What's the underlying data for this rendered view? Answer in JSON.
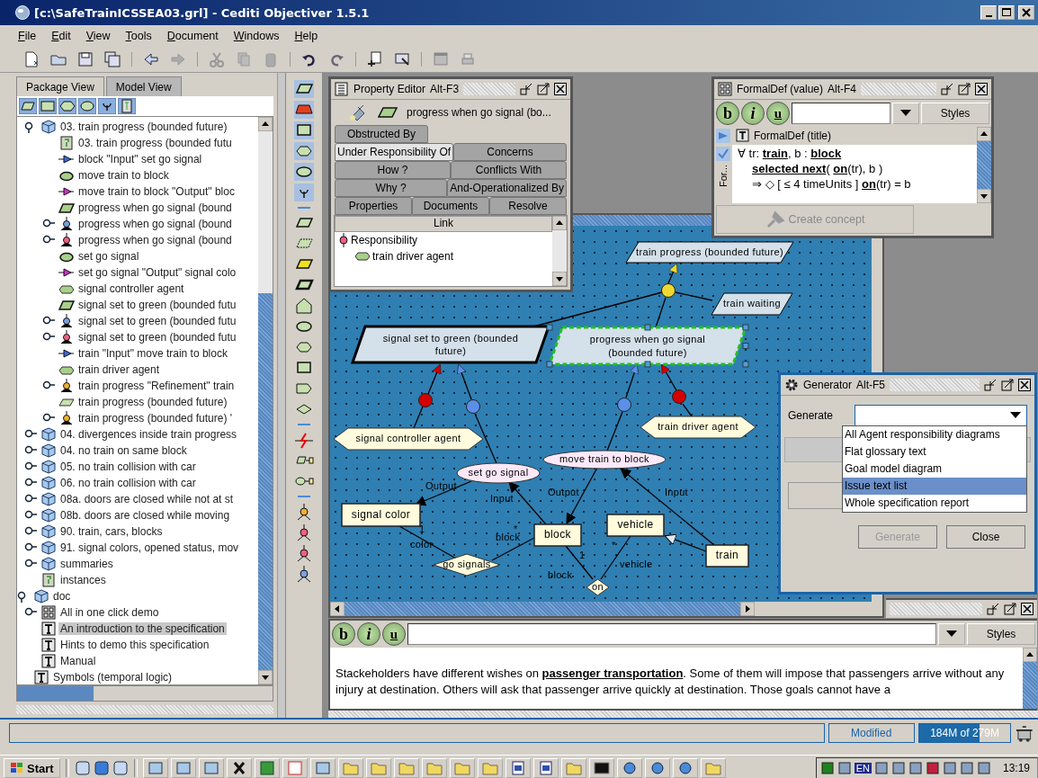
{
  "window": {
    "title": "[c:\\SafeTrainICSSEA03.grl] - Cediti Objectiver 1.5.1"
  },
  "menu": [
    "File",
    "Edit",
    "View",
    "Tools",
    "Document",
    "Windows",
    "Help"
  ],
  "left_tabs": [
    {
      "label": "Package View",
      "selected": true
    },
    {
      "label": "Model View",
      "selected": false
    }
  ],
  "tree": {
    "items": [
      {
        "children": [
          {
            "label": "03. train progress (bounded future)",
            "kind": "package",
            "expanded": true,
            "selected": false,
            "children": [
              {
                "label": "03. train progress (bounded futu",
                "kind": "diagram",
                "selected": false
              },
              {
                "label": "block \"Input\" set go signal",
                "kind": "input",
                "selected": false
              },
              {
                "label": "move train to block",
                "kind": "operation",
                "selected": false
              },
              {
                "label": "move train to block \"Output\" bloc",
                "kind": "output",
                "selected": false
              },
              {
                "label": "progress when go signal (bound",
                "kind": "goal",
                "selected": false
              },
              {
                "label": "progress when go signal (bound",
                "kind": "and-refinement",
                "expanded": false,
                "selected": false
              },
              {
                "label": "progress when go signal (bound",
                "kind": "responsibility",
                "expanded": false,
                "selected": false
              },
              {
                "label": "set go signal",
                "kind": "operation",
                "selected": false
              },
              {
                "label": "set go signal \"Output\" signal colo",
                "kind": "output",
                "selected": false
              },
              {
                "label": "signal controller agent",
                "kind": "agent",
                "selected": false
              },
              {
                "label": "signal set to green (bounded futu",
                "kind": "goal",
                "selected": false
              },
              {
                "label": "signal set to green (bounded futu",
                "kind": "and-refinement",
                "expanded": false,
                "selected": false
              },
              {
                "label": "signal set to green (bounded futu",
                "kind": "responsibility",
                "expanded": false,
                "selected": false
              },
              {
                "label": "train \"Input\" move train to block",
                "kind": "input",
                "selected": false
              },
              {
                "label": "train driver agent",
                "kind": "agent",
                "selected": false
              },
              {
                "label": "train progress \"Refinement\" train",
                "kind": "refinement",
                "expanded": false,
                "selected": false
              },
              {
                "label": "train progress (bounded future)",
                "kind": "goal-plain",
                "selected": false
              },
              {
                "label": "train progress (bounded future) '",
                "kind": "refinement",
                "expanded": false,
                "selected": false
              }
            ]
          },
          {
            "label": "04. divergences inside train progress",
            "kind": "package",
            "expanded": false,
            "selected": false
          },
          {
            "label": "04. no train on same block",
            "kind": "package",
            "expanded": false,
            "selected": false
          },
          {
            "label": "05. no train collision with car",
            "kind": "package",
            "expanded": false,
            "selected": false
          },
          {
            "label": "06. no train collision with car",
            "kind": "package",
            "expanded": false,
            "selected": false
          },
          {
            "label": "08a. doors are closed while not at st",
            "kind": "package",
            "expanded": false,
            "selected": false
          },
          {
            "label": "08b. doors are closed while moving",
            "kind": "package",
            "expanded": false,
            "selected": false
          },
          {
            "label": "90. train, cars, blocks",
            "kind": "package",
            "expanded": false,
            "selected": false
          },
          {
            "label": "91. signal colors, opened status, mov",
            "kind": "package",
            "expanded": false,
            "selected": false
          },
          {
            "label": "summaries",
            "kind": "package",
            "expanded": false,
            "selected": false
          },
          {
            "label": "instances",
            "kind": "diagram",
            "selected": false
          }
        ]
      },
      {
        "label": "doc",
        "kind": "package",
        "expanded": true,
        "selected": false,
        "children": [
          {
            "label": "All in one click demo",
            "kind": "demo",
            "expanded": false,
            "selected": false
          },
          {
            "label": "An introduction to the specification",
            "kind": "text",
            "selected": true
          },
          {
            "label": "Hints to demo this specification",
            "kind": "text",
            "selected": false
          },
          {
            "label": "Manual",
            "kind": "text",
            "selected": false
          }
        ]
      },
      {
        "label": "Symbols (temporal logic)",
        "kind": "text",
        "selected": false
      }
    ]
  },
  "property_editor": {
    "title": "Property Editor",
    "shortcut": "Alt-F3",
    "object": "progress when go signal (bo...",
    "tab_rows": [
      [
        {
          "label": "Obstructed By",
          "selected": false
        }
      ],
      [
        {
          "label": "Under Responsibility Of",
          "selected": true
        },
        {
          "label": "Concerns",
          "selected": false
        }
      ],
      [
        {
          "label": "How ?",
          "selected": false
        },
        {
          "label": "Conflicts With",
          "selected": false
        }
      ],
      [
        {
          "label": "Why ?",
          "selected": false
        },
        {
          "label": "And-Operationalized By",
          "selected": false
        }
      ],
      [
        {
          "label": "Properties",
          "selected": false
        },
        {
          "label": "Documents",
          "selected": false
        },
        {
          "label": "Resolve",
          "selected": false
        }
      ]
    ],
    "column": "Link",
    "link": {
      "label": "Responsibility",
      "child": "train driver agent"
    }
  },
  "formaldef": {
    "title": "FormalDef (value)",
    "shortcut": "Alt-F4",
    "format_buttons": [
      "b",
      "i",
      "u"
    ],
    "styles": "Styles",
    "heading": "FormalDef (title)",
    "side_tab": "For...",
    "lines": [
      "∀  tr: **train**, b : **block**",
      "**selected next**(  **on**(tr),  b )",
      "⇒ ◇ [ ≤ 4 timeUnits ]   **on**(tr) = b"
    ],
    "create": {
      "label": "Create concept",
      "disabled": true
    }
  },
  "diagram": {
    "nodes": [
      {
        "kind": "goal",
        "label": "train progress (bounded future)",
        "selected": false
      },
      {
        "kind": "refinement",
        "selected": false
      },
      {
        "kind": "goal",
        "label": "train waiting",
        "selected": false
      },
      {
        "kind": "goal-bold",
        "label": "signal set to green (bounded future)",
        "selected": false
      },
      {
        "kind": "goal-bold",
        "label": "progress when go signal (bounded future)",
        "selected": true
      },
      {
        "kind": "responsibility",
        "selected": false
      },
      {
        "kind": "operationalization",
        "selected": false
      },
      {
        "kind": "operationalization",
        "selected": false
      },
      {
        "kind": "responsibility",
        "selected": false
      },
      {
        "kind": "agent",
        "label": "signal controller agent",
        "selected": false
      },
      {
        "kind": "agent",
        "label": "train driver agent",
        "selected": false
      },
      {
        "kind": "operation",
        "label": "set go signal",
        "selected": false
      },
      {
        "kind": "operation",
        "label": "move train to block",
        "selected": false
      },
      {
        "kind": "entity",
        "label": "signal color",
        "selected": false
      },
      {
        "kind": "entity",
        "label": "block",
        "selected": false
      },
      {
        "kind": "entity",
        "label": "vehicle",
        "selected": false
      },
      {
        "kind": "entity",
        "label": "train",
        "selected": false
      },
      {
        "kind": "association",
        "label": "go signals",
        "selected": false
      },
      {
        "kind": "association",
        "label": "on",
        "selected": false
      }
    ],
    "edge_labels": [
      "Output",
      "Input",
      "Output",
      "Input",
      "1",
      "color",
      "*",
      "block",
      "1",
      "*",
      "vehicle",
      "block"
    ]
  },
  "generator": {
    "title": "Generator",
    "shortcut": "Alt-F5",
    "field_label": "Generate",
    "options": [
      {
        "label": "All Agent responsibility diagrams",
        "selected": false
      },
      {
        "label": "Flat glossary text",
        "selected": false
      },
      {
        "label": "Goal model diagram",
        "selected": false
      },
      {
        "label": "Issue text list",
        "selected": true
      },
      {
        "label": "Whole specification report",
        "selected": false
      }
    ],
    "buttons": [
      {
        "label": "Generate",
        "disabled": true
      },
      {
        "label": "Close",
        "disabled": false
      }
    ]
  },
  "editor": {
    "format_buttons": [
      "b",
      "i",
      "u"
    ],
    "styles": "Styles",
    "text": "Stackeholders have different wishes on **passenger transportation**. Some of them will impose that passengers arrive without any injury at destination. Others will ask that passenger arrive quickly at destination. Those goals cannot have a"
  },
  "status_bar": {
    "state": "Modified",
    "memory": "184M of 279M",
    "level": 0.66
  },
  "taskbar": {
    "start": "Start",
    "language": "EN",
    "clock": "13:19"
  }
}
